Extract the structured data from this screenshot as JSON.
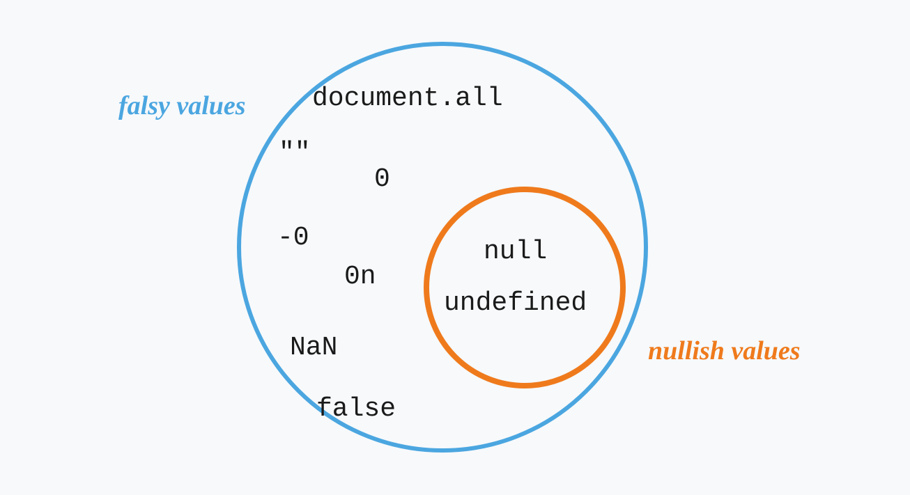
{
  "diagram": {
    "title_outer": "falsy values",
    "title_inner": "nullish values",
    "colors": {
      "outer_circle": "#4ba6e0",
      "inner_circle": "#ef7a1c",
      "background": "#f7f9fb"
    },
    "outer_values": {
      "document_all": "document.all",
      "empty_string": "\"\"",
      "zero": "0",
      "neg_zero": "-0",
      "zero_n": "0n",
      "nan": "NaN",
      "false_val": "false"
    },
    "inner_values": {
      "null_val": "null",
      "undefined_val": "undefined"
    }
  }
}
